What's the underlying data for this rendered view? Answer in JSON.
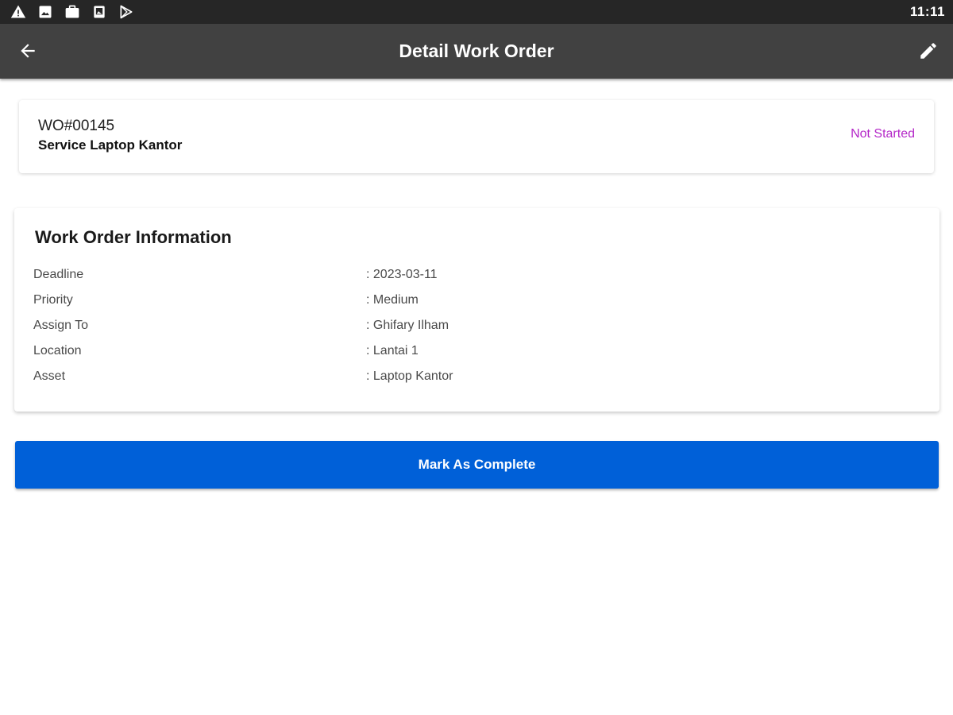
{
  "status_bar": {
    "time": "11:11",
    "icons": [
      "warning-icon",
      "image-icon",
      "briefcase-icon",
      "photo-icon",
      "play-store-icon"
    ]
  },
  "app_bar": {
    "title": "Detail Work Order",
    "back_icon": "arrow-left-icon",
    "edit_icon": "pencil-icon"
  },
  "work_order": {
    "number": "WO#00145",
    "name": "Service Laptop Kantor",
    "status": "Not Started",
    "status_color": "#b428c8"
  },
  "information": {
    "title": "Work Order Information",
    "rows": [
      {
        "label": "Deadline",
        "value": ": 2023-03-11"
      },
      {
        "label": "Priority",
        "value": ": Medium"
      },
      {
        "label": "Assign To",
        "value": ": Ghifary Ilham"
      },
      {
        "label": "Location",
        "value": ": Lantai 1"
      },
      {
        "label": "Asset",
        "value": ": Laptop Kantor"
      }
    ]
  },
  "actions": {
    "complete_label": "Mark As Complete",
    "complete_color": "#0060d8"
  }
}
